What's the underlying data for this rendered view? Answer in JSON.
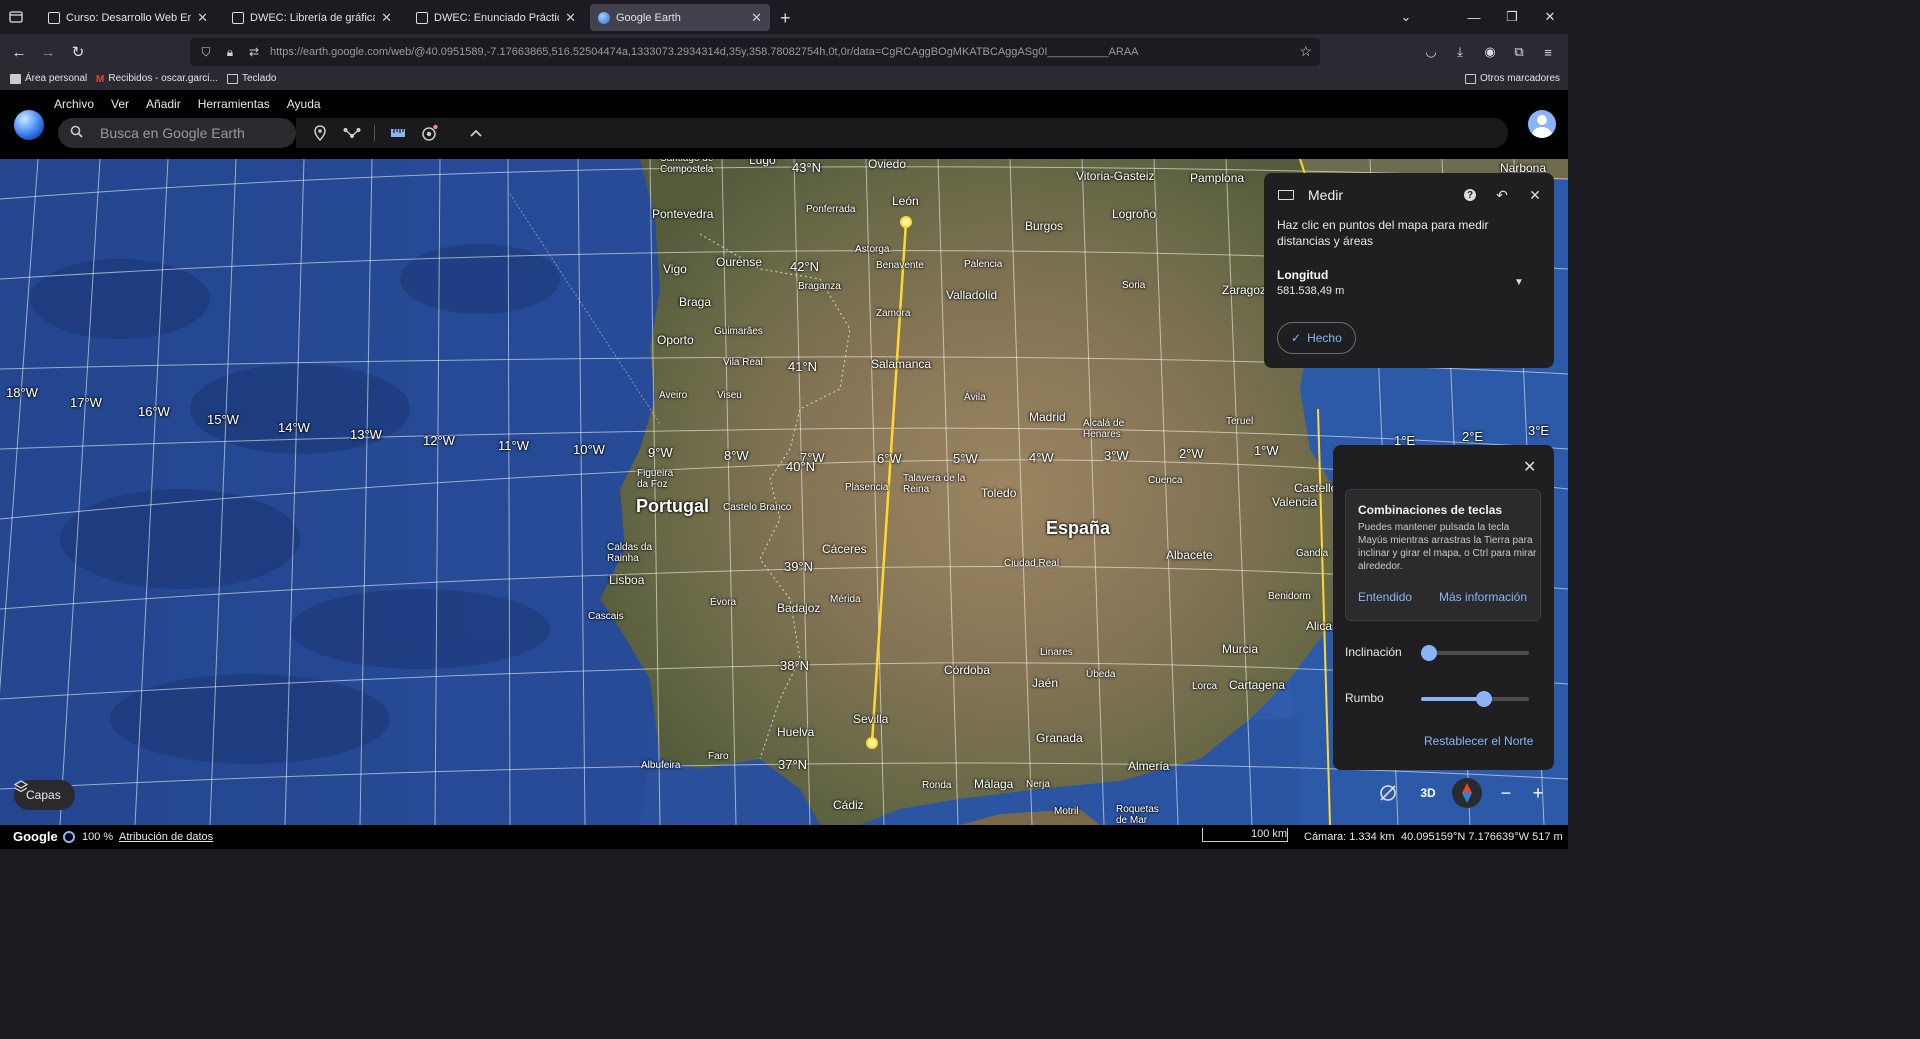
{
  "browser": {
    "tabs": [
      {
        "label": "Curso: Desarrollo Web Entorno",
        "active": false
      },
      {
        "label": "DWEC: Librería de gráficas (bar",
        "active": false
      },
      {
        "label": "DWEC: Enunciado Práctica: Cre",
        "active": false
      },
      {
        "label": "Google Earth",
        "active": true
      }
    ],
    "url": "https://earth.google.com/web/@40.0951589,-7.17663865,516.52504474a,1333073.2934314d,35y,358.78082754h,0t,0r/data=CgRCAggBOgMKATBCAggASg0I__________ARAA",
    "bookmarks": [
      "Área personal",
      "Recibidos - oscar.garci...",
      "Teclado"
    ],
    "other_bookmarks": "Otros marcadores"
  },
  "app": {
    "menu": [
      "Archivo",
      "Ver",
      "Añadir",
      "Herramientas",
      "Ayuda"
    ],
    "search_placeholder": "Busca en Google Earth",
    "layers_label": "Capas"
  },
  "measure": {
    "title": "Medir",
    "description": "Haz clic en puntos del mapa para medir distancias y áreas",
    "metric_label": "Longitud",
    "metric_value": "581.538,49 m",
    "done_label": "Hecho"
  },
  "settings": {
    "tip_title": "Combinaciones de teclas",
    "tip_body": "Puedes mantener pulsada la tecla Mayús mientras arrastras la Tierra para inclinar y girar el mapa, o Ctrl para mirar alrededor.",
    "tip_ok": "Entendido",
    "tip_more": "Más información",
    "tilt_label": "Inclinación",
    "tilt_value": 0,
    "heading_label": "Rumbo",
    "heading_value": 0.58,
    "reset_north": "Restablecer el Norte",
    "view_mode": "3D"
  },
  "status": {
    "google": "Google",
    "zoom": "100 %",
    "attribution": "Atribución de datos",
    "scale": "100 km",
    "camera": "Cámara: 1.334 km",
    "coords": "40.095159°N 7.176639°W  517 m"
  },
  "map": {
    "countries": [
      "Portugal",
      "España"
    ],
    "longitudes": [
      "18°W",
      "17°W",
      "16°W",
      "15°W",
      "14°W",
      "13°W",
      "12°W",
      "11°W",
      "10°W",
      "9°W",
      "8°W",
      "7°W",
      "6°W",
      "5°W",
      "4°W",
      "3°W",
      "2°W",
      "1°W",
      "1°E",
      "2°E",
      "3°E"
    ],
    "latitudes": [
      "43°N",
      "42°N",
      "41°N",
      "40°N",
      "39°N",
      "38°N",
      "37°N"
    ],
    "cities": [
      "Santiago de Compostela",
      "Lugo",
      "Oviedo",
      "Vitoria-Gasteiz",
      "Pamplona",
      "Narbona",
      "León",
      "Ponferrada",
      "Burgos",
      "Logroño",
      "Pontevedra",
      "Ourense",
      "Astorga",
      "Benavente",
      "Palencia",
      "Vigo",
      "Braganza",
      "Valladolid",
      "Soria",
      "Zaragoza",
      "Braga",
      "Zamora",
      "Guimarães",
      "Oporto",
      "Vila Real",
      "Salamanca",
      "Aveiro",
      "Viseu",
      "Ávila",
      "Madrid",
      "Alcalá de Henares",
      "Teruel",
      "Figueira da Foz",
      "Plasencia",
      "Talavera de la Reina",
      "Toledo",
      "Castelo Branco",
      "Cuenca",
      "Castellón",
      "Valencia",
      "Caldas da Rainha",
      "Lisboa",
      "Cáceres",
      "Ciudad Real",
      "Albacete",
      "Gandia",
      "Évora",
      "Mérida",
      "Badajoz",
      "Cascais",
      "Benidorm",
      "Alicante",
      "Linares",
      "Murcia",
      "Córdoba",
      "Úbeda",
      "Jaén",
      "Lorca",
      "Cartagena",
      "Sevilla",
      "Huelva",
      "Faro",
      "Albufeira",
      "Granada",
      "Almería",
      "Ronda",
      "Málaga",
      "Nerja",
      "Cádiz",
      "Motril",
      "Roquetas de Mar"
    ]
  }
}
